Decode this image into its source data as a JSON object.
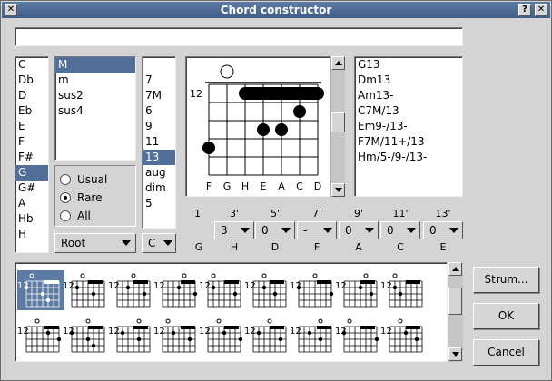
{
  "window": {
    "title": "Chord constructor",
    "help_btn": "?",
    "close_btn": "✕",
    "sys_btn": "✕"
  },
  "name_field": {
    "value": ""
  },
  "roots": {
    "items": [
      "C",
      "Db",
      "D",
      "Eb",
      "E",
      "F",
      "F#",
      "G",
      "G#",
      "A",
      "Hb",
      "H"
    ],
    "selected": 7
  },
  "types": {
    "items": [
      "M",
      "m",
      "sus2",
      "sus4"
    ],
    "selected": 0
  },
  "modes": {
    "items": [
      "Usual",
      "Rare",
      "All"
    ],
    "selected": 1
  },
  "root_combo": {
    "value": "Root"
  },
  "ext": {
    "items": [
      "7",
      "7M",
      "6",
      "9",
      "11",
      "13",
      "aug",
      "dim",
      "5"
    ],
    "selected": 5
  },
  "bass_combo": {
    "value": "C"
  },
  "diagram": {
    "fret": "12",
    "strings": [
      "F",
      "G",
      "H",
      "E",
      "A",
      "C",
      "D"
    ],
    "open_marks": [
      {
        "string": 1,
        "type": "open"
      }
    ],
    "barre": {
      "from": 2,
      "to": 6,
      "fret": 1
    },
    "dots": [
      {
        "string": 5,
        "fret": 2
      },
      {
        "string": 3,
        "fret": 3
      },
      {
        "string": 4,
        "fret": 3
      },
      {
        "string": 0,
        "fret": 4
      }
    ]
  },
  "chord_names": [
    "G13",
    "Dm13",
    "Am13-",
    "C7M/13",
    "Em9-/13-",
    "F7M/11+/13",
    "Hm/5-/9-/13-"
  ],
  "intervals": {
    "labels": [
      "1'",
      "3'",
      "5'",
      "7'",
      "9'",
      "11'",
      "13'"
    ],
    "values": [
      "3",
      "0",
      "-",
      "0",
      "0",
      "0"
    ],
    "notes": [
      "G",
      "H",
      "D",
      "F",
      "A",
      "C",
      "E"
    ]
  },
  "voicings_fret": "12",
  "buttons": {
    "strum": "Strum...",
    "ok": "OK",
    "cancel": "Cancel"
  }
}
